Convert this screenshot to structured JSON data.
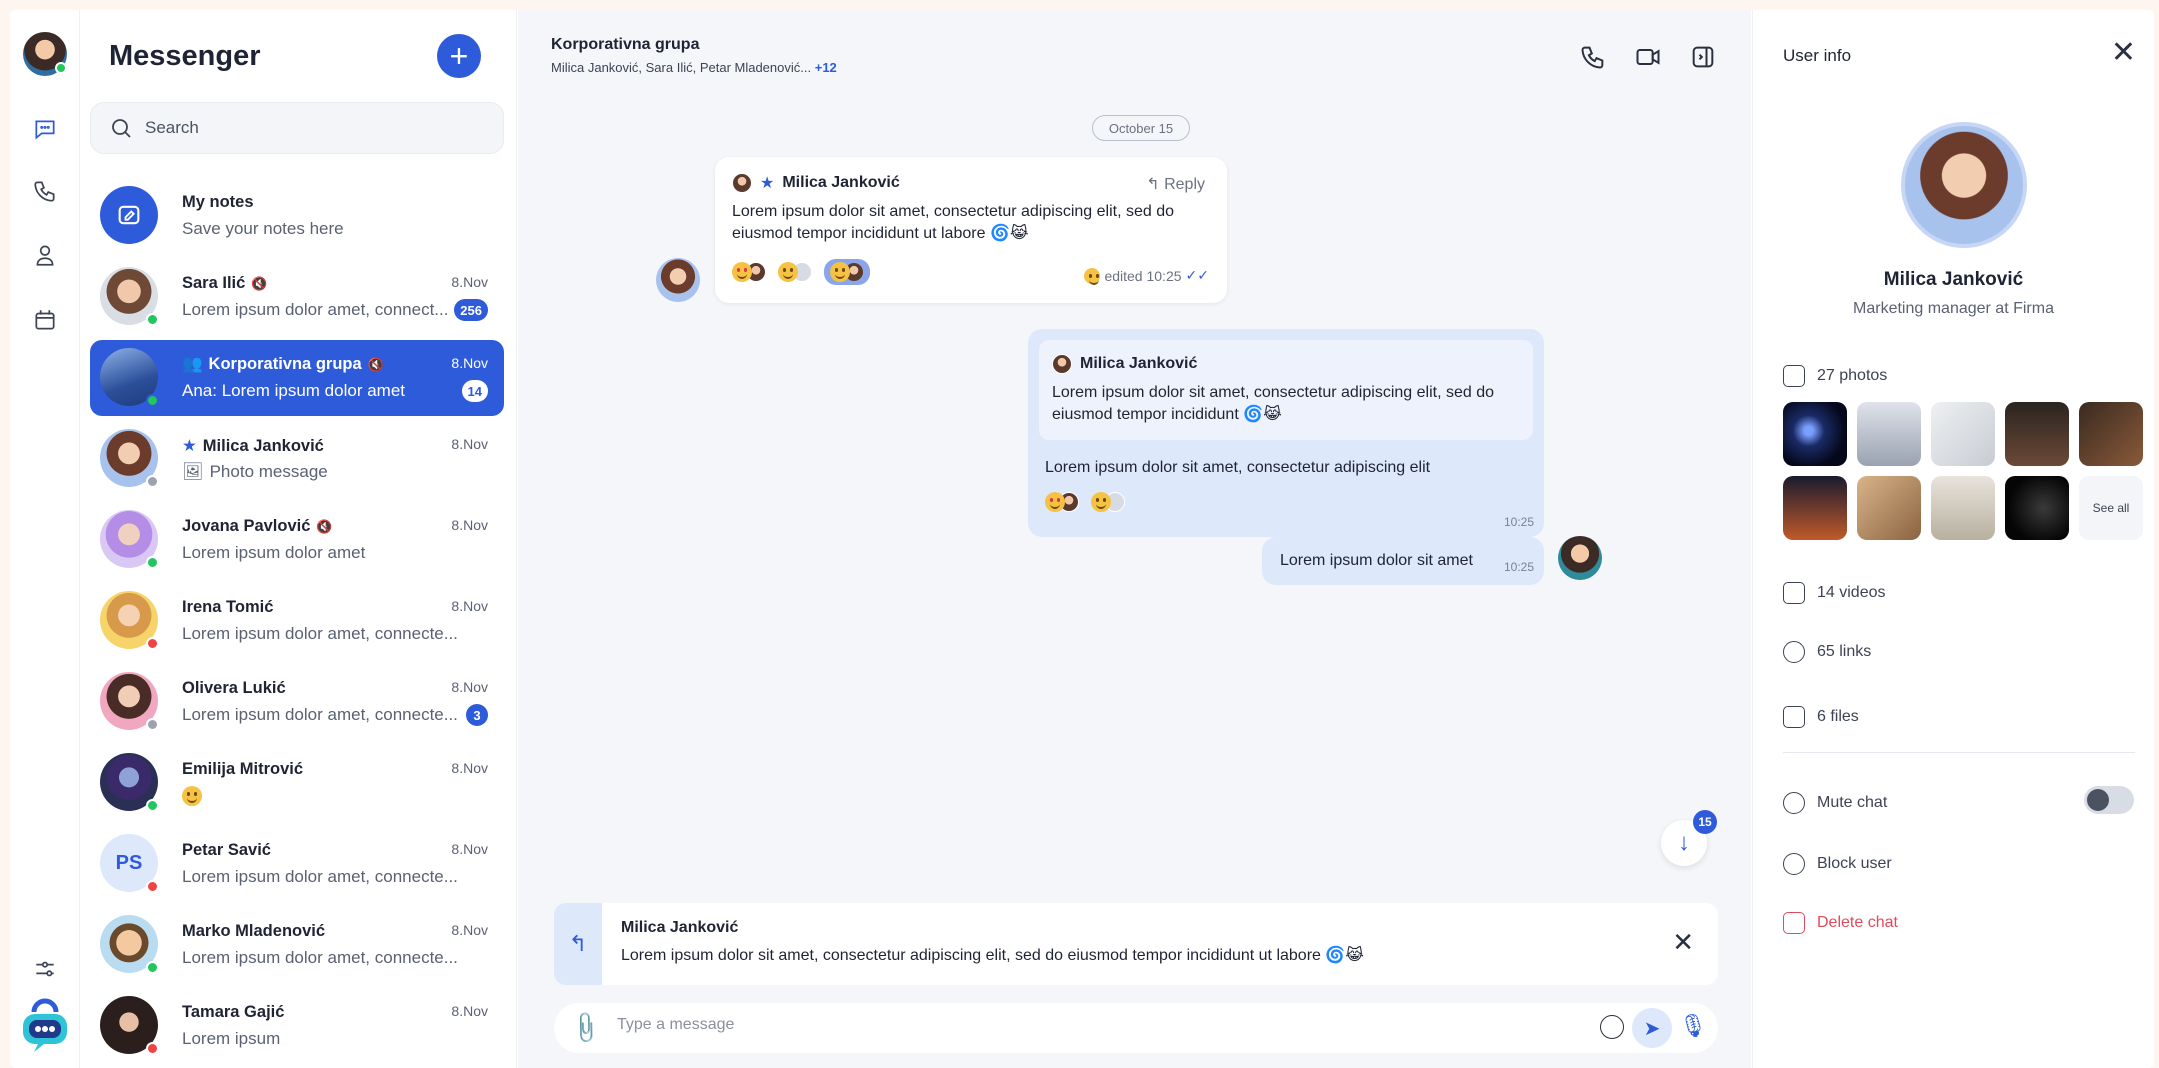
{
  "rail": {
    "icons": [
      "chat-icon",
      "phone-icon",
      "contacts-icon",
      "calendar-icon",
      "settings-icon"
    ]
  },
  "list": {
    "title": "Messenger",
    "new_button": "+",
    "search_placeholder": "Search",
    "items": [
      {
        "name": "My notes",
        "preview": "Save your notes here",
        "date": "",
        "badge": "",
        "status": ""
      },
      {
        "name": "Sara Ilić",
        "preview": "Lorem ipsum dolor amet, connect...",
        "date": "8.Nov",
        "badge": "256",
        "status": "online"
      },
      {
        "name": "Korporativna grupa",
        "preview": "Ana: Lorem ipsum dolor amet",
        "date": "8.Nov",
        "badge": "14",
        "status": "online"
      },
      {
        "name": "Milica Janković",
        "preview": "Photo message",
        "date": "8.Nov",
        "badge": "",
        "status": "offline"
      },
      {
        "name": "Jovana Pavlović",
        "preview": "Lorem ipsum dolor amet",
        "date": "8.Nov",
        "badge": "",
        "status": "online"
      },
      {
        "name": "Irena Tomić",
        "preview": "Lorem ipsum dolor amet, connecte...",
        "date": "8.Nov",
        "badge": "",
        "status": "busy"
      },
      {
        "name": "Olivera Lukić",
        "preview": "Lorem ipsum dolor amet, connecte...",
        "date": "8.Nov",
        "badge": "3",
        "status": "offline"
      },
      {
        "name": "Emilija Mitrović",
        "preview": "😀",
        "date": "8.Nov",
        "badge": "",
        "status": "online"
      },
      {
        "name": "Petar Savić",
        "preview": "Lorem ipsum dolor amet, connecte...",
        "date": "8.Nov",
        "badge": "",
        "status": "busy",
        "initials": "PS"
      },
      {
        "name": "Marko Mladenović",
        "preview": "Lorem ipsum dolor amet, connecte...",
        "date": "8.Nov",
        "badge": "",
        "status": "online"
      },
      {
        "name": "Tamara Gajić",
        "preview": "Lorem ipsum",
        "date": "8.Nov",
        "badge": "",
        "status": "busy"
      }
    ]
  },
  "chat": {
    "title": "Korporativna grupa",
    "members": "Milica Janković, Sara Ilić, Petar Mladenović...",
    "members_more": "+12",
    "date_chip": "October 15",
    "message1": {
      "sender": "Milica Janković",
      "reply_label": "Reply",
      "text": "Lorem ipsum dolor sit amet, consectetur adipiscing elit, sed do eiusmod tempor incididunt ut labore",
      "meta": "edited 10:25"
    },
    "message2": {
      "quote_sender": "Milica Janković",
      "quote_text": "Lorem ipsum dolor sit amet, consectetur adipiscing elit, sed do eiusmod tempor incididunt",
      "text": "Lorem ipsum dolor sit amet, consectetur adipiscing elit",
      "time": "10:25"
    },
    "message3": {
      "text": "Lorem ipsum dolor sit amet",
      "time": "10:25"
    },
    "scroll_badge": "15",
    "reply_bar": {
      "name": "Milica Janković",
      "text": "Lorem ipsum dolor sit amet, consectetur adipiscing elit, sed do eiusmod tempor incididunt ut labore"
    },
    "composer_placeholder": "Type a message"
  },
  "info": {
    "title": "User info",
    "name": "Milica Janković",
    "role": "Marketing manager at Firma",
    "photos_label": "27 photos",
    "see_all": "See all",
    "videos_label": "14 videos",
    "links_label": "65 links",
    "files_label": "6 files",
    "mute_label": "Mute chat",
    "block_label": "Block user",
    "delete_label": "Delete chat"
  },
  "colors": {
    "accent": "#2e5bda",
    "online": "#22c55e",
    "busy": "#ef4444",
    "offline": "#9ca3af",
    "danger": "#e14c5c"
  }
}
